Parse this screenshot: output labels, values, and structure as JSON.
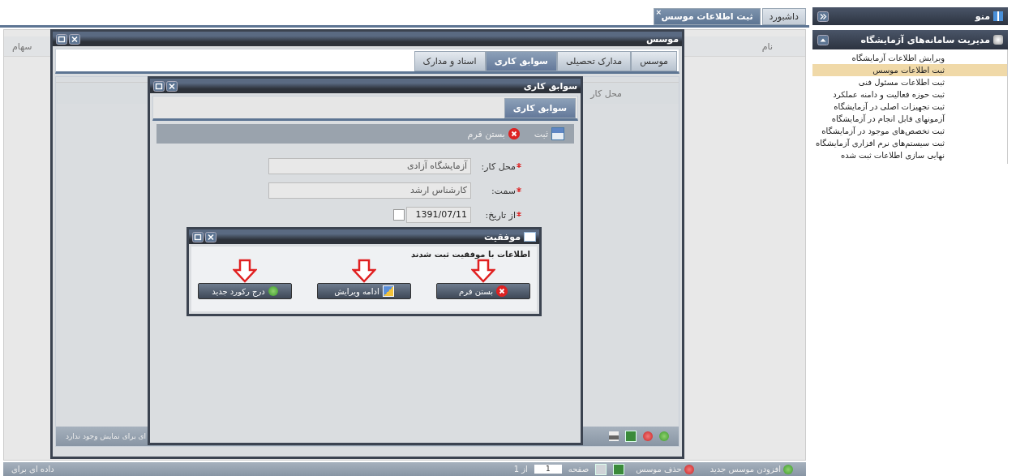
{
  "sidebar": {
    "title": "منو",
    "section": {
      "title": "مدیریت سامانه‌های آزمایشگاه",
      "expanded": true,
      "items": [
        {
          "label": "ویرایش اطلاعات آزمایشگاه",
          "selected": false
        },
        {
          "label": "ثبت اطلاعات موسس",
          "selected": true
        },
        {
          "label": "ثبت اطلاعات مسئول فنی",
          "selected": false
        },
        {
          "label": "ثبت حوزه فعالیت و دامنه عملکرد",
          "selected": false
        },
        {
          "label": "ثبت تجهیزات اصلی در آزمایشگاه",
          "selected": false
        },
        {
          "label": "آزمونهای قابل انجام در آزمایشگاه",
          "selected": false
        },
        {
          "label": "ثبت تخصص‌های موجود در آزمایشگاه",
          "selected": false
        },
        {
          "label": "ثبت سیستم‌های نرم افزاری آزمایشگاه",
          "selected": false
        },
        {
          "label": "نهایی سازی اطلاعات ثبت شده",
          "selected": false
        }
      ]
    }
  },
  "tabs": [
    {
      "label": "داشبورد",
      "selected": false
    },
    {
      "label": "ثبت اطلاعات موسس",
      "selected": true,
      "close_glyph": "×"
    }
  ],
  "grid": {
    "columns": [
      "نام",
      "سهام"
    ],
    "toolbar": {
      "add": "افزودن موسس جدید",
      "delete": "حذف موسس",
      "page_label": "صفحه",
      "page_value": "1",
      "page_total": "از 1",
      "empty_text": "داده ای برای"
    }
  },
  "founder_window": {
    "title": "موسس",
    "tabs": [
      {
        "label": "موسس",
        "selected": false
      },
      {
        "label": "مدارک تحصیلی",
        "selected": false
      },
      {
        "label": "سوابق کاری",
        "selected": true
      },
      {
        "label": "اسناد و مدارک",
        "selected": false
      }
    ],
    "grid_column": "محل کار",
    "empty_text": "ای برای نمایش وجود ندارد"
  },
  "work_window": {
    "title": "سوابق کاری",
    "tabs": [
      {
        "label": "سوابق کاری",
        "selected": true
      }
    ],
    "toolbar": {
      "save": "ثبت",
      "close": "بستن فرم"
    },
    "fields": [
      {
        "label": "محل کار:",
        "required": true,
        "value": "آزمایشگاه آزادی",
        "kind": "text"
      },
      {
        "label": "سمت:",
        "required": true,
        "value": "کارشناس ارشد",
        "kind": "text"
      },
      {
        "label": "از تاریخ:",
        "required": true,
        "value": "1391/07/11",
        "kind": "date"
      }
    ]
  },
  "dialog": {
    "title": "موفقیت",
    "message": "اطلاعات با موفقیت ثبت شدند",
    "buttons": [
      {
        "label": "بستن فرم",
        "kind": "close"
      },
      {
        "label": "ادامه ویرایش",
        "kind": "edit"
      },
      {
        "label": "درج رکورد جدید",
        "kind": "add"
      }
    ]
  }
}
